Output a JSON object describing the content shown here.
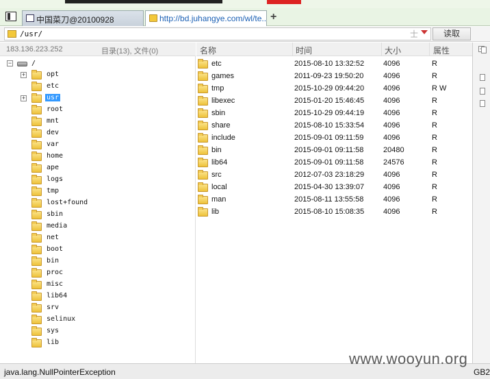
{
  "tabs": [
    {
      "label": "中国菜刀@20100928"
    },
    {
      "label": "http://bd.juhangye.com/wl/te..."
    }
  ],
  "new_tab_label": "+",
  "address": {
    "value": "/usr/",
    "extra": "士",
    "read_label": "读取"
  },
  "left_header": {
    "ip": "183.136.223.252",
    "counts": "目录(13), 文件(0)"
  },
  "tree": {
    "root_label": "/",
    "items": [
      {
        "label": "opt",
        "expandable": true
      },
      {
        "label": "etc"
      },
      {
        "label": "usr",
        "expandable": true,
        "selected": true
      },
      {
        "label": "root"
      },
      {
        "label": "mnt"
      },
      {
        "label": "dev"
      },
      {
        "label": "var"
      },
      {
        "label": "home"
      },
      {
        "label": "ape"
      },
      {
        "label": "logs"
      },
      {
        "label": "tmp"
      },
      {
        "label": "lost+found"
      },
      {
        "label": "sbin"
      },
      {
        "label": "media"
      },
      {
        "label": "net"
      },
      {
        "label": "boot"
      },
      {
        "label": "bin"
      },
      {
        "label": "proc"
      },
      {
        "label": "misc"
      },
      {
        "label": "lib64"
      },
      {
        "label": "srv"
      },
      {
        "label": "selinux"
      },
      {
        "label": "sys"
      },
      {
        "label": "lib"
      }
    ]
  },
  "columns": {
    "name": "名称",
    "time": "时间",
    "size": "大小",
    "attr": "属性"
  },
  "files": [
    {
      "name": "etc",
      "time": "2015-08-10 13:32:52",
      "size": "4096",
      "attr": "R"
    },
    {
      "name": "games",
      "time": "2011-09-23 19:50:20",
      "size": "4096",
      "attr": "R"
    },
    {
      "name": "tmp",
      "time": "2015-10-29 09:44:20",
      "size": "4096",
      "attr": "R W"
    },
    {
      "name": "libexec",
      "time": "2015-01-20 15:46:45",
      "size": "4096",
      "attr": "R"
    },
    {
      "name": "sbin",
      "time": "2015-10-29 09:44:19",
      "size": "4096",
      "attr": "R"
    },
    {
      "name": "share",
      "time": "2015-08-10 15:33:54",
      "size": "4096",
      "attr": "R"
    },
    {
      "name": "include",
      "time": "2015-09-01 09:11:59",
      "size": "4096",
      "attr": "R"
    },
    {
      "name": "bin",
      "time": "2015-09-01 09:11:58",
      "size": "20480",
      "attr": "R"
    },
    {
      "name": "lib64",
      "time": "2015-09-01 09:11:58",
      "size": "24576",
      "attr": "R"
    },
    {
      "name": "src",
      "time": "2012-07-03 23:18:29",
      "size": "4096",
      "attr": "R"
    },
    {
      "name": "local",
      "time": "2015-04-30 13:39:07",
      "size": "4096",
      "attr": "R"
    },
    {
      "name": "man",
      "time": "2015-08-11 13:55:58",
      "size": "4096",
      "attr": "R"
    },
    {
      "name": "lib",
      "time": "2015-08-10 15:08:35",
      "size": "4096",
      "attr": "R"
    }
  ],
  "status": {
    "message": "java.lang.NullPointerException",
    "encoding": "GB2"
  },
  "watermark": "www.wooyun.org",
  "icons": {
    "folder": "folder-icon",
    "drive": "drive-icon",
    "expander": "expander-icon"
  },
  "colors": {
    "selection": "#3399ff",
    "folder": "#eec23a",
    "tab_link": "#1a5fb4"
  }
}
